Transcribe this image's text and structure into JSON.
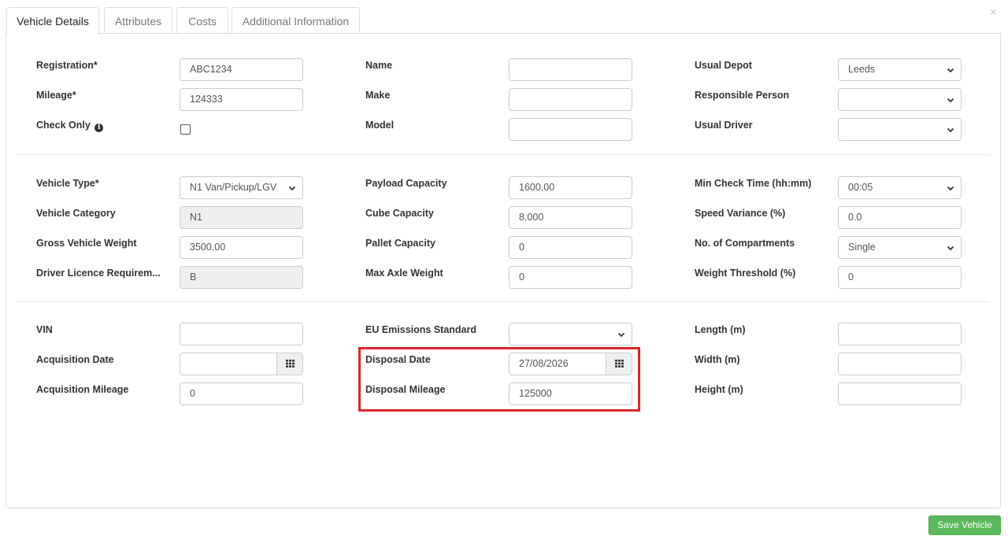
{
  "dialog": {
    "close_glyph": "×"
  },
  "tabs": [
    {
      "label": "Vehicle Details",
      "active": true
    },
    {
      "label": "Attributes",
      "active": false
    },
    {
      "label": "Costs",
      "active": false
    },
    {
      "label": "Additional Information",
      "active": false
    }
  ],
  "section1": {
    "registration": {
      "label": "Registration*",
      "value": "ABC1234"
    },
    "mileage": {
      "label": "Mileage*",
      "value": "124333"
    },
    "check_only": {
      "label": "Check Only",
      "checked": false,
      "icon": "info-circle-icon"
    },
    "name": {
      "label": "Name",
      "value": ""
    },
    "make": {
      "label": "Make",
      "value": ""
    },
    "model": {
      "label": "Model",
      "value": ""
    },
    "usual_depot": {
      "label": "Usual Depot",
      "value": "Leeds"
    },
    "responsible_person": {
      "label": "Responsible Person",
      "value": ""
    },
    "usual_driver": {
      "label": "Usual Driver",
      "value": ""
    }
  },
  "section2": {
    "vehicle_type": {
      "label": "Vehicle Type*",
      "value": "N1 Van/Pickup/LGV"
    },
    "vehicle_category": {
      "label": "Vehicle Category",
      "value": "N1"
    },
    "gross_vehicle_weight": {
      "label": "Gross Vehicle Weight",
      "value": "3500.00"
    },
    "driver_licence": {
      "label": "Driver Licence Requirem...",
      "value": "B"
    },
    "payload_capacity": {
      "label": "Payload Capacity",
      "value": "1600.00"
    },
    "cube_capacity": {
      "label": "Cube Capacity",
      "value": "8.000"
    },
    "pallet_capacity": {
      "label": "Pallet Capacity",
      "value": "0"
    },
    "max_axle_weight": {
      "label": "Max Axle Weight",
      "value": "0"
    },
    "min_check_time": {
      "label": "Min Check Time (hh:mm)",
      "value": "00:05"
    },
    "speed_variance": {
      "label": "Speed Variance (%)",
      "value": "0.0"
    },
    "compartments": {
      "label": "No. of Compartments",
      "value": "Single"
    },
    "weight_threshold": {
      "label": "Weight Threshold (%)",
      "value": "0"
    }
  },
  "section3": {
    "vin": {
      "label": "VIN",
      "value": ""
    },
    "acquisition_date": {
      "label": "Acquisition Date",
      "value": ""
    },
    "acquisition_mileage": {
      "label": "Acquisition Mileage",
      "value": "0"
    },
    "eu_emissions": {
      "label": "EU Emissions Standard",
      "value": ""
    },
    "disposal_date": {
      "label": "Disposal Date",
      "value": "27/08/2026"
    },
    "disposal_mileage": {
      "label": "Disposal Mileage",
      "value": "125000"
    },
    "length": {
      "label": "Length (m)",
      "value": ""
    },
    "width": {
      "label": "Width (m)",
      "value": ""
    },
    "height": {
      "label": "Height (m)",
      "value": ""
    }
  },
  "actions": {
    "save_label": "Save Vehicle"
  },
  "colors": {
    "highlight": "#d9262c",
    "save": "#5cb85c"
  }
}
